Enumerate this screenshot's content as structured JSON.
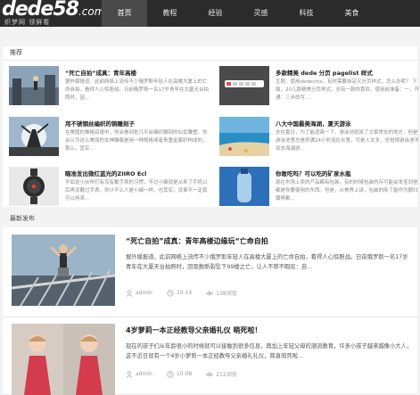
{
  "header": {
    "logo_main": "dede",
    "logo_num": "58",
    "logo_suffix": ".com",
    "logo_tagline": "织梦网 领鲜看"
  },
  "nav": [
    {
      "label": "首页",
      "active": true
    },
    {
      "label": "教程"
    },
    {
      "label": "经验"
    },
    {
      "label": "灵感"
    },
    {
      "label": "科技"
    },
    {
      "label": "美食"
    }
  ],
  "recommend": {
    "heading": "推荐",
    "items": [
      {
        "title": "“死亡自拍”成真：青年高楼",
        "desc": "据外媒报道，此前网络上流传不少俄罗斯年轻人在高楼大厦上的亡命自拍，看得人心惊胆战。日前俄罗斯一名17岁青年在大厦天台拍照时，因..."
      },
      {
        "title": "多款精美 dede 分页 pagelist 样式",
        "desc": "主题：使用dedecms，有时需要自定义分页样式，怎么办呢？ 下面，20几款精美分页样式，总有一款你喜欢。使用前准备：一，开通：三步即可..."
      },
      {
        "title": "用不锈钢丝编织的铜雕刻子",
        "desc": "在美国的佛格琼德中，你会看到佐凡平丝编织雕刻的仙女雕塑。你会认为这么美丽的女神雕像是用一种规格或者贵重金属织构成的，那么，其实..."
      },
      {
        "title": "八大中国最美海湖，夏天游泳",
        "desc": "夫在夏日，为了能适爽一下，游泳池就成了大家常去的地方，但是游泳池里总是挤满24小时泡在水里，可是人太多，总觉得游泳池不如去海湖游..."
      },
      {
        "title": "瞄准发出微红蓝光的ZIIRO Ecl",
        "desc": "不如这小伙伴们有没有戴手表的习惯，不过小编就是从来了手机以后再没戴过手表。你计不么人是小编一样，也其实，没事不一定真可以用来..."
      },
      {
        "title": "你敢吃吗？可以吃的矿泉水瓶",
        "desc": "现在市场上卖的产品都有包装，有的时候包装的存可能会本宝到他都是你要使用的东西。但是，从美界上讲，包装的除了能作为额归属啊都..."
      }
    ]
  },
  "latest": {
    "heading": "最新发布",
    "items": [
      {
        "title": "“死亡自拍”成真：青年高楼边缘玩“亡命自拍",
        "desc": "据外媒报道，此前网络上流传不少俄罗斯年轻人在高楼大厦上的亡命自拍，看得人心惊胆战。日前俄罗斯一名17岁青年在大厦天台拍照时，因现数断裂坠下99楼之亡，让人不禁不暇叹：自...",
        "author": "admin",
        "date": "10-14",
        "views": "138浏览"
      },
      {
        "title": "4岁萝莉一本正经教导父亲婚礼仪 萌死啦！",
        "desc": "现在的孩子们从年龄很小的时候就可以接触到很多信息，再加上年轻父母的潮流教育，许多小孩子越来越像小大人，这不近日就有一个4岁小萝莉一本正经教导父亲婚礼礼仪，简直萌死啦...",
        "author": "admin",
        "date": "10-08",
        "views": "212浏览"
      }
    ]
  },
  "colors": {
    "topbar": "#2b2b2b",
    "nav_active": "#4a4a4a",
    "logo_accent": "#ffffff"
  }
}
